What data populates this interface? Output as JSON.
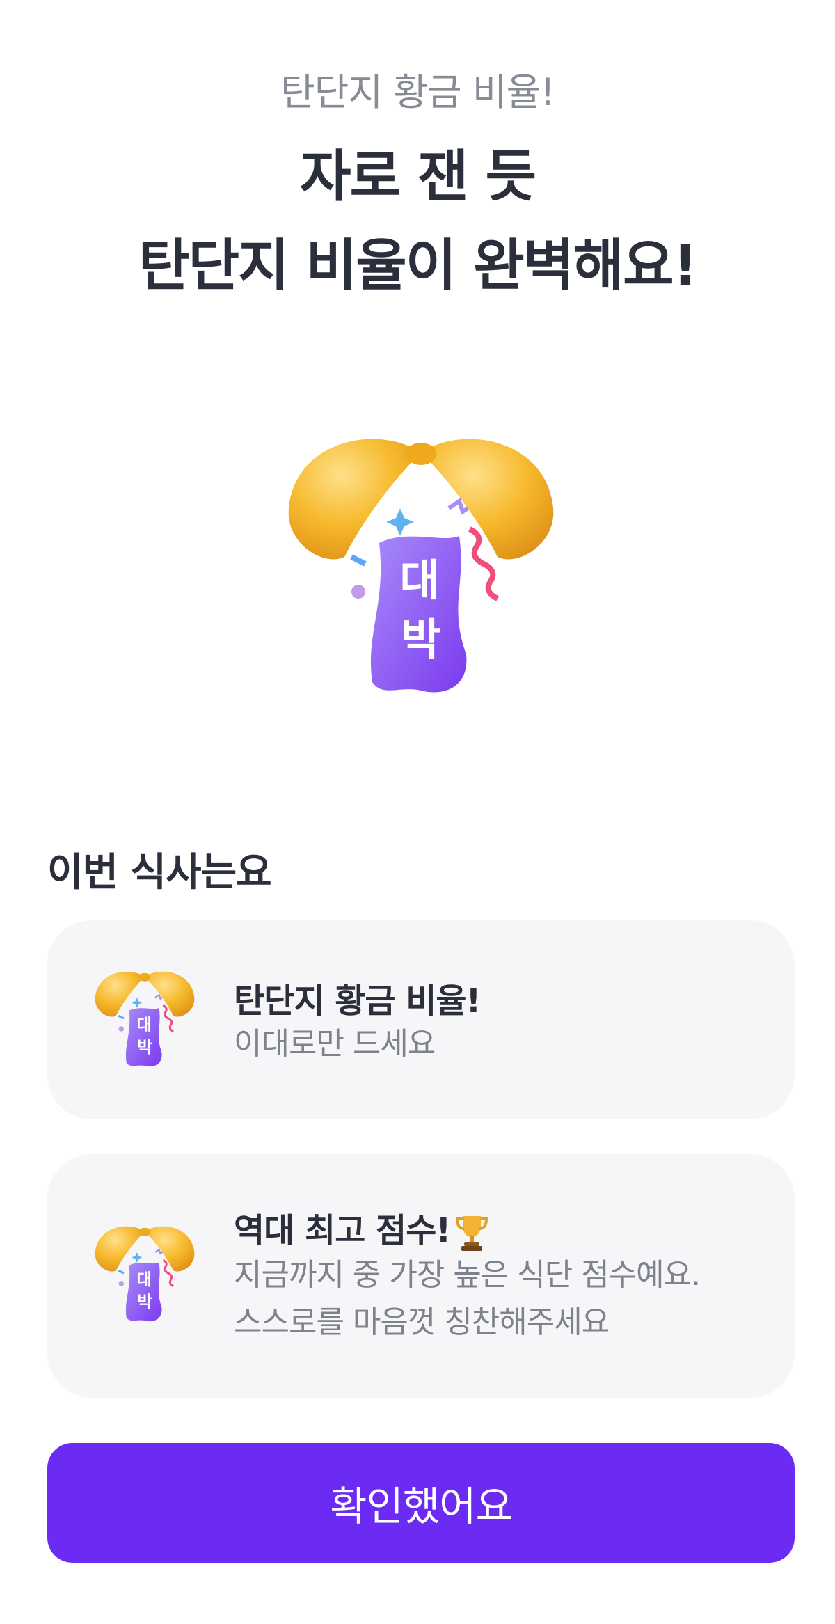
{
  "header": {
    "subtitle": "탄단지 황금 비율!",
    "title_line1": "자로 잰 듯",
    "title_line2": "탄단지 비율이 완벽해요!"
  },
  "hero": {
    "icon": "jackpot-fortune-cookie-icon",
    "badge_text_1": "대",
    "badge_text_2": "박"
  },
  "meal_section": {
    "label": "이번 식사는요",
    "cards": [
      {
        "icon": "jackpot-fortune-cookie-icon",
        "title": "탄단지 황금 비율!",
        "desc_line1": "이대로만 드세요",
        "desc_line2": ""
      },
      {
        "icon": "jackpot-fortune-cookie-icon",
        "title": "역대 최고 점수!",
        "title_icon": "trophy-icon",
        "desc_line1": "지금까지 중 가장 높은 식단 점수예요.",
        "desc_line2": "스스로를 마음껏 칭찬해주세요"
      }
    ]
  },
  "actions": {
    "confirm_label": "확인했어요"
  },
  "colors": {
    "accent": "#6c2bf2",
    "card_bg": "#f6f6f8",
    "title_text": "#2b2e3b",
    "muted_text": "#868b94",
    "shell_yellow": "#f6b92c",
    "badge_purple": "#8b5cf6"
  }
}
